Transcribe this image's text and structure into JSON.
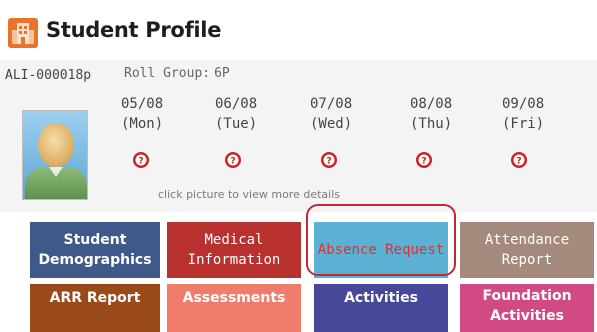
{
  "header": {
    "title": "Student Profile",
    "icon": "building-icon",
    "icon_color": "#e8732a"
  },
  "student": {
    "id": "ALI-000018p",
    "roll_group_label": "Roll Group:",
    "roll_group": "6P",
    "hint": "click picture to view more details"
  },
  "days": [
    {
      "date": "05/08",
      "name": "(Mon)",
      "status_icon": "unknown-status-icon"
    },
    {
      "date": "06/08",
      "name": "(Tue)",
      "status_icon": "unknown-status-icon"
    },
    {
      "date": "07/08",
      "name": "(Wed)",
      "status_icon": "unknown-status-icon"
    },
    {
      "date": "08/08",
      "name": "(Thu)",
      "status_icon": "unknown-status-icon"
    },
    {
      "date": "09/08",
      "name": "(Fri)",
      "status_icon": "unknown-status-icon"
    }
  ],
  "tiles": {
    "demographics": "Student Demographics",
    "medical": "Medical Information",
    "absence": "Absence Request",
    "attendance": "Attendance Report",
    "arr": "ARR Report",
    "assessments": "Assessments",
    "activities": "Activities",
    "foundation": "Foundation Activities"
  },
  "colors": {
    "demographics": "#3f5a8a",
    "medical": "#b8312f",
    "absence": "#5bb1d3",
    "absence_text": "#e2302b",
    "attendance": "#a48a7c",
    "arr": "#9a4a18",
    "assessments": "#f07c6b",
    "activities": "#48489a",
    "foundation": "#d14a83",
    "highlight": "#c2273a",
    "status_icon": "#cc2222"
  }
}
